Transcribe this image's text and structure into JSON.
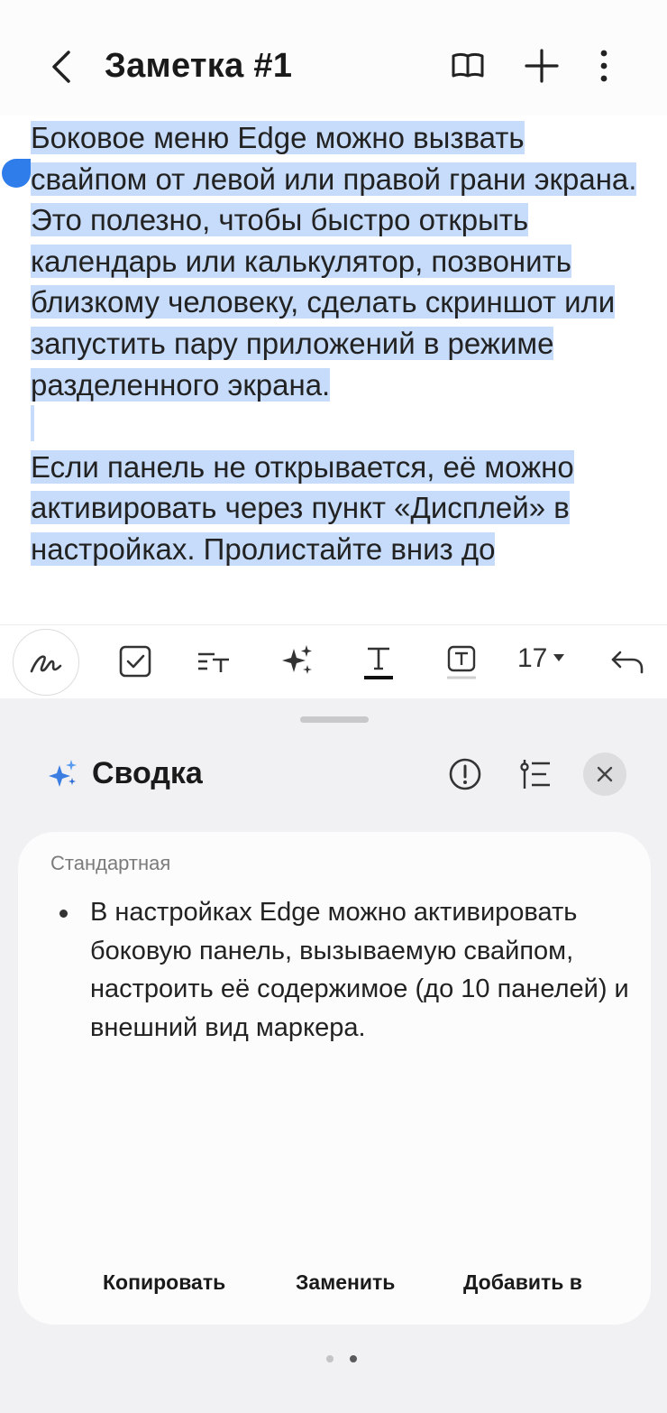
{
  "header": {
    "title": "Заметка #1",
    "icons": [
      "back-icon",
      "reading-mode-icon",
      "plus-icon",
      "more-icon"
    ]
  },
  "note": {
    "paragraph1": "Боковое меню Edge можно вызвать свайпом от левой или правой грани экрана. Это полезно, чтобы быстро открыть календарь или калькулятор, позвонить близкому человеку, сделать скриншот или запустить пару приложений в режиме разделенного экрана.",
    "paragraph2": "Если панель не открывается, её можно активировать через пункт «Дисплей» в настройках. Пролистайте вниз до",
    "selection_color": "#c7dcfa",
    "handle_color": "#2f7dea"
  },
  "toolbar": {
    "font_size": "17",
    "icons": [
      "handwriting-icon",
      "checkbox-icon",
      "text-style-icon",
      "ai-sparkle-icon",
      "underline-text-icon",
      "text-box-icon",
      "font-size-dropdown-icon",
      "undo-icon"
    ]
  },
  "summary_sheet": {
    "title": "Сводка",
    "mode_label": "Стандартная",
    "bullet": "В настройках Edge можно активировать боковую панель, вызываемую свайпом, настроить её содержимое (до 10 панелей) и внешний вид маркера.",
    "actions": {
      "copy": "Копировать",
      "replace": "Заменить",
      "add_to": "Добавить в"
    },
    "page_dots": 2,
    "active_page": 2
  }
}
